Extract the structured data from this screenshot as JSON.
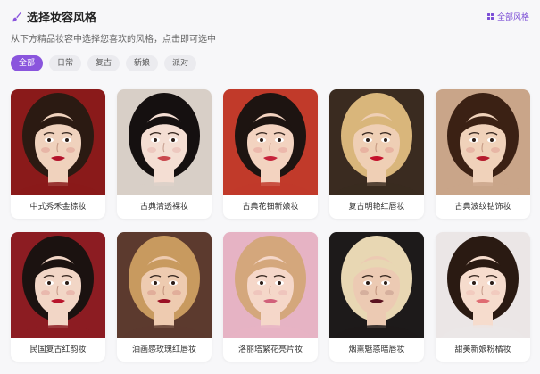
{
  "header": {
    "title": "选择妆容风格",
    "brush_icon": "brush-icon",
    "all_link": "全部风格",
    "all_icon": "grid-icon",
    "accent": "#8a55dd"
  },
  "subtitle": "从下方精品妆容中选择您喜欢的风格，点击即可选中",
  "tabs": [
    {
      "label": "全部",
      "active": true
    },
    {
      "label": "日常",
      "active": false
    },
    {
      "label": "复古",
      "active": false
    },
    {
      "label": "新娘",
      "active": false
    },
    {
      "label": "派对",
      "active": false
    }
  ],
  "cards": [
    {
      "label": "中式秀禾金棕妆",
      "bg": "#8a1a1a",
      "hair": "#2b1a12",
      "skin": "#f0d2bd",
      "lip": "#b3122a"
    },
    {
      "label": "古典清透裸妆",
      "bg": "#d8cfc7",
      "hair": "#151010",
      "skin": "#f4ded3",
      "lip": "#c9484e"
    },
    {
      "label": "古典花钿新娘妆",
      "bg": "#c13a2a",
      "hair": "#1d1411",
      "skin": "#f3d3c0",
      "lip": "#c6243b"
    },
    {
      "label": "复古明艳红唇妆",
      "bg": "#3a2b20",
      "hair": "#d9b67b",
      "skin": "#efcfb5",
      "lip": "#c4122c"
    },
    {
      "label": "古典波纹钻饰妆",
      "bg": "#c9a589",
      "hair": "#3b2114",
      "skin": "#f0d2ba",
      "lip": "#b51b2d"
    },
    {
      "label": "民国复古红韵妆",
      "bg": "#8c1c22",
      "hair": "#1b1210",
      "skin": "#f2d6c6",
      "lip": "#b8142b"
    },
    {
      "label": "油画感玫瑰红唇妆",
      "bg": "#5c3a2e",
      "hair": "#c89a5f",
      "skin": "#eecbb0",
      "lip": "#9a1024"
    },
    {
      "label": "洛丽塔繁花亮片妆",
      "bg": "#e6b3c4",
      "hair": "#d4a77c",
      "skin": "#f5d7c9",
      "lip": "#d1607a"
    },
    {
      "label": "烟熏魅惑暗唇妆",
      "bg": "#1d1a1a",
      "hair": "#e8d7b3",
      "skin": "#eccab3",
      "lip": "#5a1220"
    },
    {
      "label": "甜美新娘粉橘妆",
      "bg": "#ebe6e6",
      "hair": "#2a1a12",
      "skin": "#f6dccd",
      "lip": "#df6c72"
    }
  ]
}
